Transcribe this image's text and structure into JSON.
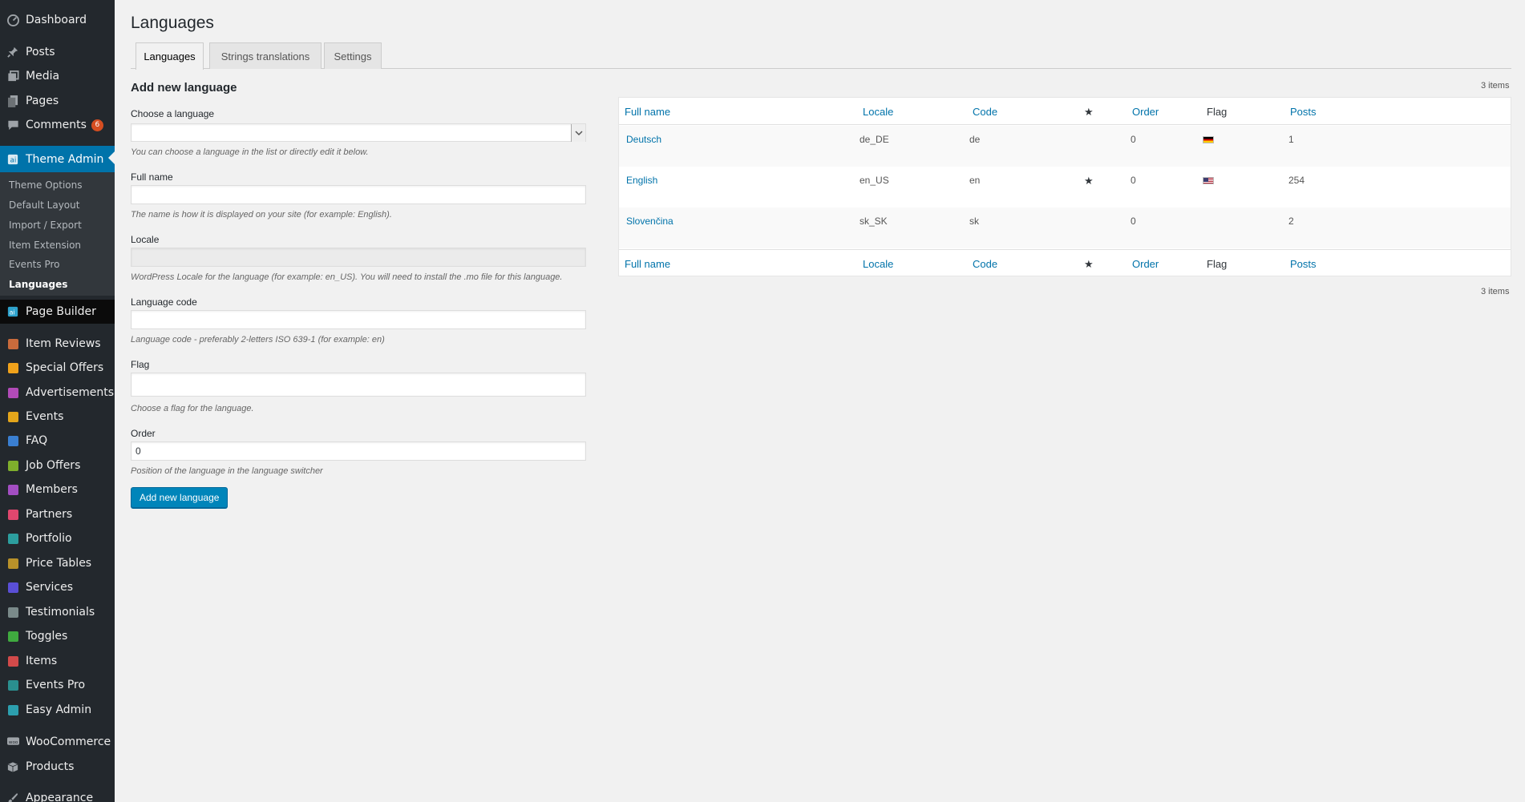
{
  "sidebar": {
    "dashboard": "Dashboard",
    "posts": "Posts",
    "media": "Media",
    "pages": "Pages",
    "comments": "Comments",
    "comments_badge": "6",
    "theme_admin": "Theme Admin",
    "theme_submenu": [
      "Theme Options",
      "Default Layout",
      "Import / Export",
      "Item Extension",
      "Events Pro",
      "Languages"
    ],
    "page_builder": "Page Builder",
    "items": [
      {
        "label": "Item Reviews",
        "color": "#c96b3c",
        "icon": "star-icon"
      },
      {
        "label": "Special Offers",
        "color": "#f0a21b",
        "icon": "tag-icon"
      },
      {
        "label": "Advertisements",
        "color": "#b14bb8",
        "icon": "ad-icon"
      },
      {
        "label": "Events",
        "color": "#e3a51b",
        "icon": "calendar-icon"
      },
      {
        "label": "FAQ",
        "color": "#3a7fd1",
        "icon": "question-icon"
      },
      {
        "label": "Job Offers",
        "color": "#7fae2c",
        "icon": "briefcase-icon"
      },
      {
        "label": "Members",
        "color": "#a34ec2",
        "icon": "user-icon"
      },
      {
        "label": "Partners",
        "color": "#e0476e",
        "icon": "heart-icon"
      },
      {
        "label": "Portfolio",
        "color": "#2c9e9e",
        "icon": "image-icon"
      },
      {
        "label": "Price Tables",
        "color": "#b8912a",
        "icon": "dollar-icon"
      },
      {
        "label": "Services",
        "color": "#5a4fd6",
        "icon": "gear-icon"
      },
      {
        "label": "Testimonials",
        "color": "#7a8a8a",
        "icon": "quote-icon"
      },
      {
        "label": "Toggles",
        "color": "#3faa3f",
        "icon": "toggle-icon"
      },
      {
        "label": "Items",
        "color": "#d24a4a",
        "icon": "list-icon"
      },
      {
        "label": "Events Pro",
        "color": "#2a8f8f",
        "icon": "calendar-pro-icon"
      },
      {
        "label": "Easy Admin",
        "color": "#2c9fae",
        "icon": "admin-icon"
      }
    ],
    "woocommerce": "WooCommerce",
    "products": "Products",
    "appearance": "Appearance"
  },
  "page": {
    "title": "Languages",
    "tabs": [
      "Languages",
      "Strings translations",
      "Settings"
    ]
  },
  "form": {
    "heading": "Add new language",
    "choose_label": "Choose a language",
    "choose_desc": "You can choose a language in the list or directly edit it below.",
    "fullname_label": "Full name",
    "fullname_desc": "The name is how it is displayed on your site (for example: English).",
    "locale_label": "Locale",
    "locale_desc": "WordPress Locale for the language (for example: en_US). You will need to install the .mo file for this language.",
    "code_label": "Language code",
    "code_desc": "Language code - preferably 2-letters ISO 639-1 (for example: en)",
    "flag_label": "Flag",
    "flag_desc": "Choose a flag for the language.",
    "order_label": "Order",
    "order_value": "0",
    "order_desc": "Position of the language in the language switcher",
    "submit": "Add new language"
  },
  "table": {
    "count_top": "3 items",
    "count_bottom": "3 items",
    "headers": {
      "full_name": "Full name",
      "locale": "Locale",
      "code": "Code",
      "default": "★",
      "order": "Order",
      "flag": "Flag",
      "posts": "Posts"
    },
    "rows": [
      {
        "name": "Deutsch",
        "locale": "de_DE",
        "code": "de",
        "default": "",
        "order": "0",
        "flag": "de",
        "posts": "1"
      },
      {
        "name": "English",
        "locale": "en_US",
        "code": "en",
        "default": "★",
        "order": "0",
        "flag": "us",
        "posts": "254"
      },
      {
        "name": "Slovenčina",
        "locale": "sk_SK",
        "code": "sk",
        "default": "",
        "order": "0",
        "flag": "",
        "posts": "2"
      }
    ]
  }
}
